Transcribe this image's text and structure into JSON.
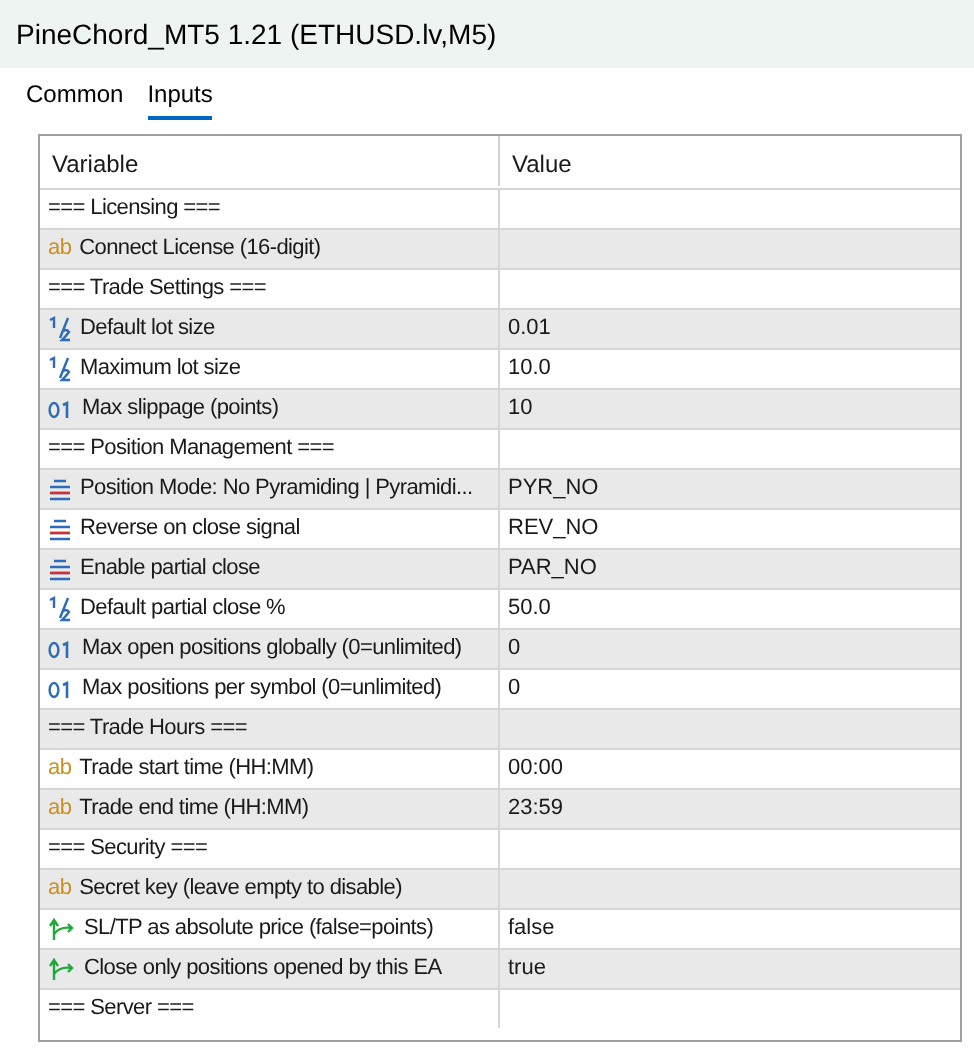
{
  "window": {
    "title": "PineChord_MT5 1.21 (ETHUSD.lv,M5)"
  },
  "tabs": [
    {
      "label": "Common",
      "selected": false
    },
    {
      "label": "Inputs",
      "selected": true
    }
  ],
  "table": {
    "columns": [
      "Variable",
      "Value"
    ],
    "rows": [
      {
        "kind": "section",
        "variable": "=== Licensing ==="
      },
      {
        "kind": "string",
        "icon": "ab",
        "variable": "Connect License (16-digit)"
      },
      {
        "kind": "section",
        "variable": "=== Trade Settings ==="
      },
      {
        "kind": "double",
        "variable": "Default lot size",
        "value": "0.01"
      },
      {
        "kind": "double",
        "variable": "Maximum lot size",
        "value": "10.0"
      },
      {
        "kind": "int",
        "variable": "Max slippage (points)",
        "value": "10"
      },
      {
        "kind": "section",
        "variable": "=== Position Management ==="
      },
      {
        "kind": "enum",
        "variable": "Position Mode: No Pyramiding | Pyramidi...",
        "value": "PYR_NO"
      },
      {
        "kind": "enum",
        "variable": "Reverse on close signal",
        "value": "REV_NO"
      },
      {
        "kind": "enum",
        "variable": "Enable partial close",
        "value": "PAR_NO"
      },
      {
        "kind": "double",
        "variable": "Default partial close %",
        "value": "50.0"
      },
      {
        "kind": "int",
        "variable": "Max open positions globally (0=unlimited)",
        "value": "0"
      },
      {
        "kind": "int",
        "variable": "Max positions per symbol (0=unlimited)",
        "value": "0"
      },
      {
        "kind": "section",
        "variable": "=== Trade Hours ==="
      },
      {
        "kind": "string",
        "icon": "ab",
        "variable": "Trade start time (HH:MM)",
        "value": "00:00"
      },
      {
        "kind": "string",
        "icon": "ab",
        "variable": "Trade end time (HH:MM)",
        "value": "23:59"
      },
      {
        "kind": "section",
        "variable": "=== Security ==="
      },
      {
        "kind": "string",
        "icon": "ab",
        "variable": "Secret key (leave empty to disable)"
      },
      {
        "kind": "bool",
        "variable": "SL/TP as absolute price (false=points)",
        "value": "false"
      },
      {
        "kind": "bool",
        "variable": "Close only positions opened by this EA",
        "value": "true"
      },
      {
        "kind": "section",
        "variable": "=== Server ==="
      }
    ]
  }
}
